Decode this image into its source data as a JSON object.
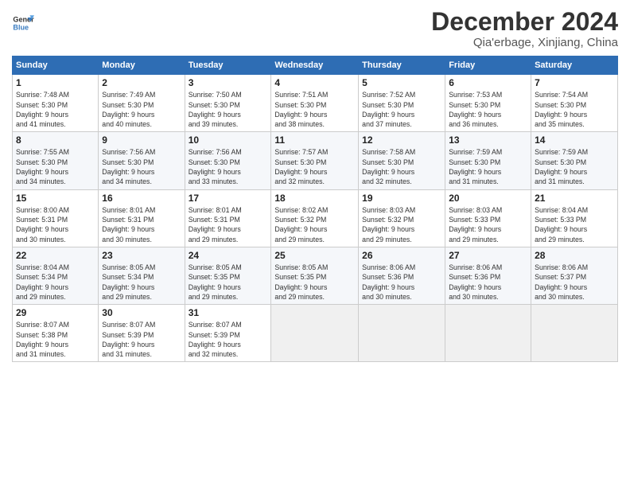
{
  "header": {
    "logo_line1": "General",
    "logo_line2": "Blue",
    "title": "December 2024",
    "subtitle": "Qia'erbage, Xinjiang, China"
  },
  "days_of_week": [
    "Sunday",
    "Monday",
    "Tuesday",
    "Wednesday",
    "Thursday",
    "Friday",
    "Saturday"
  ],
  "weeks": [
    [
      {
        "day": "1",
        "info": "Sunrise: 7:48 AM\nSunset: 5:30 PM\nDaylight: 9 hours\nand 41 minutes."
      },
      {
        "day": "2",
        "info": "Sunrise: 7:49 AM\nSunset: 5:30 PM\nDaylight: 9 hours\nand 40 minutes."
      },
      {
        "day": "3",
        "info": "Sunrise: 7:50 AM\nSunset: 5:30 PM\nDaylight: 9 hours\nand 39 minutes."
      },
      {
        "day": "4",
        "info": "Sunrise: 7:51 AM\nSunset: 5:30 PM\nDaylight: 9 hours\nand 38 minutes."
      },
      {
        "day": "5",
        "info": "Sunrise: 7:52 AM\nSunset: 5:30 PM\nDaylight: 9 hours\nand 37 minutes."
      },
      {
        "day": "6",
        "info": "Sunrise: 7:53 AM\nSunset: 5:30 PM\nDaylight: 9 hours\nand 36 minutes."
      },
      {
        "day": "7",
        "info": "Sunrise: 7:54 AM\nSunset: 5:30 PM\nDaylight: 9 hours\nand 35 minutes."
      }
    ],
    [
      {
        "day": "8",
        "info": "Sunrise: 7:55 AM\nSunset: 5:30 PM\nDaylight: 9 hours\nand 34 minutes."
      },
      {
        "day": "9",
        "info": "Sunrise: 7:56 AM\nSunset: 5:30 PM\nDaylight: 9 hours\nand 34 minutes."
      },
      {
        "day": "10",
        "info": "Sunrise: 7:56 AM\nSunset: 5:30 PM\nDaylight: 9 hours\nand 33 minutes."
      },
      {
        "day": "11",
        "info": "Sunrise: 7:57 AM\nSunset: 5:30 PM\nDaylight: 9 hours\nand 32 minutes."
      },
      {
        "day": "12",
        "info": "Sunrise: 7:58 AM\nSunset: 5:30 PM\nDaylight: 9 hours\nand 32 minutes."
      },
      {
        "day": "13",
        "info": "Sunrise: 7:59 AM\nSunset: 5:30 PM\nDaylight: 9 hours\nand 31 minutes."
      },
      {
        "day": "14",
        "info": "Sunrise: 7:59 AM\nSunset: 5:30 PM\nDaylight: 9 hours\nand 31 minutes."
      }
    ],
    [
      {
        "day": "15",
        "info": "Sunrise: 8:00 AM\nSunset: 5:31 PM\nDaylight: 9 hours\nand 30 minutes."
      },
      {
        "day": "16",
        "info": "Sunrise: 8:01 AM\nSunset: 5:31 PM\nDaylight: 9 hours\nand 30 minutes."
      },
      {
        "day": "17",
        "info": "Sunrise: 8:01 AM\nSunset: 5:31 PM\nDaylight: 9 hours\nand 29 minutes."
      },
      {
        "day": "18",
        "info": "Sunrise: 8:02 AM\nSunset: 5:32 PM\nDaylight: 9 hours\nand 29 minutes."
      },
      {
        "day": "19",
        "info": "Sunrise: 8:03 AM\nSunset: 5:32 PM\nDaylight: 9 hours\nand 29 minutes."
      },
      {
        "day": "20",
        "info": "Sunrise: 8:03 AM\nSunset: 5:33 PM\nDaylight: 9 hours\nand 29 minutes."
      },
      {
        "day": "21",
        "info": "Sunrise: 8:04 AM\nSunset: 5:33 PM\nDaylight: 9 hours\nand 29 minutes."
      }
    ],
    [
      {
        "day": "22",
        "info": "Sunrise: 8:04 AM\nSunset: 5:34 PM\nDaylight: 9 hours\nand 29 minutes."
      },
      {
        "day": "23",
        "info": "Sunrise: 8:05 AM\nSunset: 5:34 PM\nDaylight: 9 hours\nand 29 minutes."
      },
      {
        "day": "24",
        "info": "Sunrise: 8:05 AM\nSunset: 5:35 PM\nDaylight: 9 hours\nand 29 minutes."
      },
      {
        "day": "25",
        "info": "Sunrise: 8:05 AM\nSunset: 5:35 PM\nDaylight: 9 hours\nand 29 minutes."
      },
      {
        "day": "26",
        "info": "Sunrise: 8:06 AM\nSunset: 5:36 PM\nDaylight: 9 hours\nand 30 minutes."
      },
      {
        "day": "27",
        "info": "Sunrise: 8:06 AM\nSunset: 5:36 PM\nDaylight: 9 hours\nand 30 minutes."
      },
      {
        "day": "28",
        "info": "Sunrise: 8:06 AM\nSunset: 5:37 PM\nDaylight: 9 hours\nand 30 minutes."
      }
    ],
    [
      {
        "day": "29",
        "info": "Sunrise: 8:07 AM\nSunset: 5:38 PM\nDaylight: 9 hours\nand 31 minutes."
      },
      {
        "day": "30",
        "info": "Sunrise: 8:07 AM\nSunset: 5:39 PM\nDaylight: 9 hours\nand 31 minutes."
      },
      {
        "day": "31",
        "info": "Sunrise: 8:07 AM\nSunset: 5:39 PM\nDaylight: 9 hours\nand 32 minutes."
      },
      {
        "day": "",
        "info": ""
      },
      {
        "day": "",
        "info": ""
      },
      {
        "day": "",
        "info": ""
      },
      {
        "day": "",
        "info": ""
      }
    ]
  ]
}
